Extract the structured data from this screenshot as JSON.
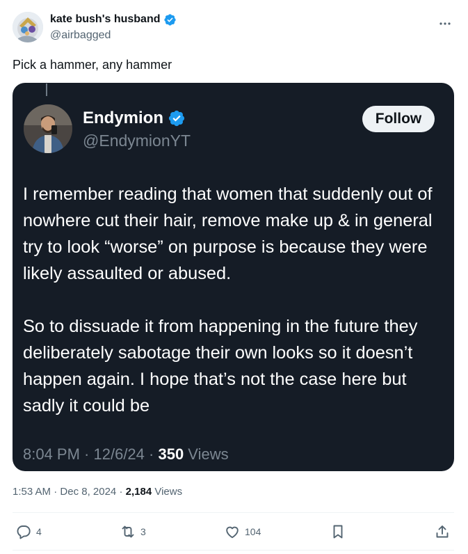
{
  "tweet": {
    "author": {
      "display_name": "kate bush's husband",
      "handle": "@airbagged",
      "verified": true
    },
    "text": "Pick a hammer, any hammer",
    "timestamp": {
      "time": "1:53 AM",
      "separator1": " · ",
      "date": "Dec 8, 2024",
      "separator2": " · ",
      "views_count": "2,184",
      "views_label": " Views"
    },
    "actions": {
      "reply_count": "4",
      "retweet_count": "3",
      "like_count": "104"
    }
  },
  "quote": {
    "author": {
      "display_name": "Endymion",
      "handle": "@EndymionYT",
      "verified": true
    },
    "follow_label": "Follow",
    "paragraph1": "I remember reading that women that suddenly out of nowhere cut their hair, remove make up & in general try to look “worse” on purpose is because they were likely assaulted or abused.",
    "paragraph2": "So to dissuade it from happening in the future they deliberately sabotage their own looks so it doesn’t happen again. I hope that’s not the case here but sadly it could be",
    "timestamp": {
      "time": "8:04 PM",
      "separator1": " · ",
      "date": "12/6/24",
      "separator2": " · ",
      "views_count": "350",
      "views_label": " Views"
    }
  },
  "colors": {
    "verified_blue": "#1d9bf0",
    "quote_background": "#151c26",
    "secondary_text": "#536471"
  },
  "icons": {
    "more": "more-dots-icon",
    "reply": "reply-bubble-icon",
    "retweet": "retweet-arrows-icon",
    "like": "heart-icon",
    "bookmark": "bookmark-icon",
    "share": "share-upload-icon"
  }
}
